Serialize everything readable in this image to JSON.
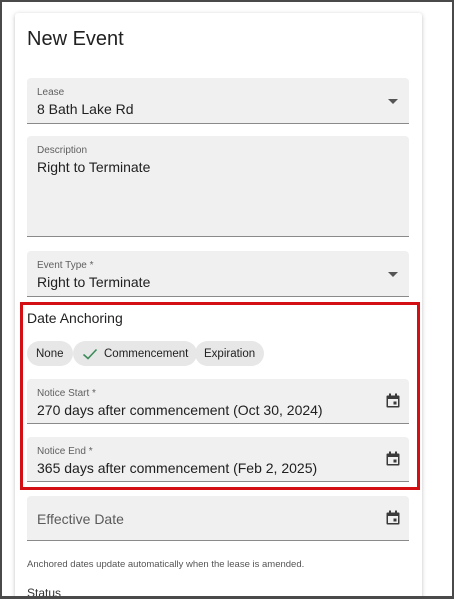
{
  "form": {
    "title": "New Event",
    "lease": {
      "label": "Lease",
      "value": "8 Bath Lake Rd"
    },
    "description": {
      "label": "Description",
      "value": "Right to Terminate"
    },
    "event_type": {
      "label": "Event Type *",
      "value": "Right to Terminate"
    },
    "date_anchoring": {
      "title": "Date Anchoring",
      "chips": [
        {
          "label": "None",
          "selected": false
        },
        {
          "label": "Commencement",
          "selected": true
        },
        {
          "label": "Expiration",
          "selected": false
        }
      ]
    },
    "notice_start": {
      "label": "Notice Start *",
      "value": "270 days after commencement (Oct 30, 2024)"
    },
    "notice_end": {
      "label": "Notice End *",
      "value": "365 days after commencement (Feb 2, 2025)"
    },
    "effective_date": {
      "placeholder": "Effective Date"
    },
    "hint": "Anchored dates update automatically when the lease is amended.",
    "status_label": "Status"
  },
  "colors": {
    "highlight": "#d30f14",
    "check": "#3d8b5a",
    "field_bg": "#f0f0f0"
  },
  "icons": [
    "chevron-down-icon",
    "calendar-icon",
    "check-icon"
  ]
}
